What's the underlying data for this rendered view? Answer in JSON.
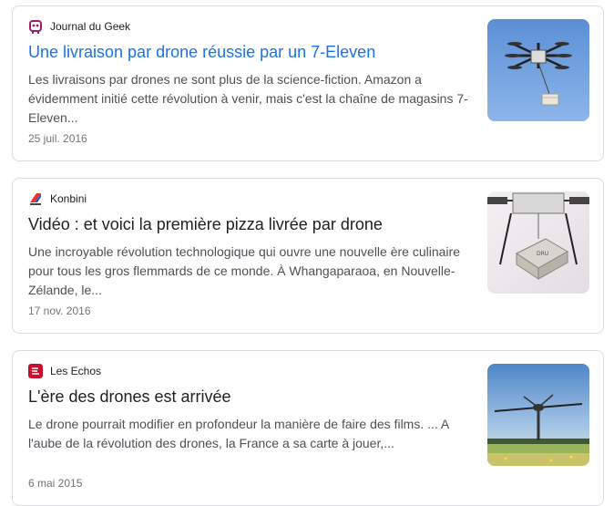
{
  "articles": [
    {
      "source": "Journal du Geek",
      "favicon": "journal-du-geek-logo",
      "title": "Une livraison par drone réussie par un 7-Eleven",
      "snippet": "Les livraisons par drones ne sont plus de la science-fiction. Amazon a évidemment initié cette révolution à venir, mais c'est la chaîne de magasins 7-Eleven...",
      "date": "25 juil. 2016",
      "title_color": "#1a73e8",
      "thumbnail": "drone-carrying-package-sky"
    },
    {
      "source": "Konbini",
      "favicon": "konbini-logo",
      "title": "Vidéo : et voici la première pizza livrée par drone",
      "snippet": "Une incroyable révolution technologique qui ouvre une nouvelle ère culinaire pour tous les gros flemmards de ce monde. À Whangaparaoa, en Nouvelle-Zélande, le...",
      "date": "17 nov. 2016",
      "title_color": "#202124",
      "thumbnail": "drone-carrying-pizza-box"
    },
    {
      "source": "Les Echos",
      "favicon": "les-echos-logo",
      "title": "L'ère des drones est arrivée",
      "snippet": "Le drone pourrait modifier en profondeur la manière de faire des films. ... A l'aube de la révolution des drones, la France a sa carte à jouer,...",
      "date": "6 mai 2015",
      "title_color": "#202124",
      "thumbnail": "drone-over-field"
    }
  ]
}
